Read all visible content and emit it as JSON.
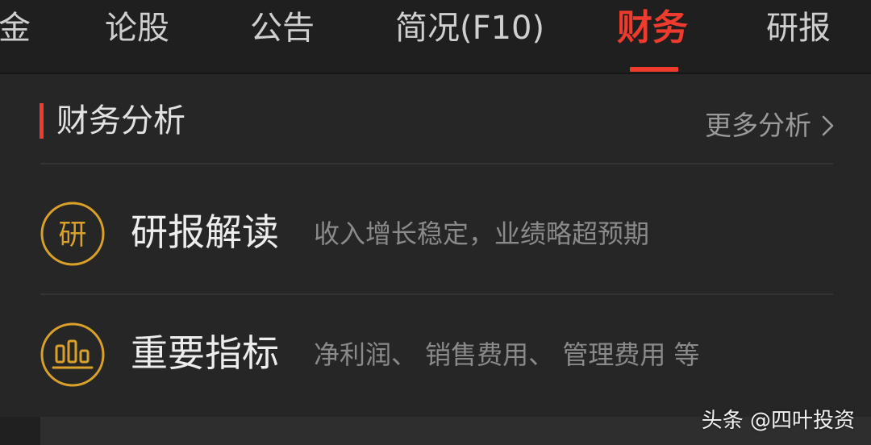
{
  "tabs": [
    {
      "label": "金",
      "active": false
    },
    {
      "label": "论股",
      "active": false
    },
    {
      "label": "公告",
      "active": false
    },
    {
      "label": "简况(F10)",
      "active": false
    },
    {
      "label": "财务",
      "active": true
    },
    {
      "label": "研报",
      "active": false
    }
  ],
  "section": {
    "title": "财务分析",
    "more_label": "更多分析",
    "more_icon": "chevron-right-icon"
  },
  "rows": [
    {
      "icon": "research-report-icon",
      "icon_glyph": "研",
      "title": "研报解读",
      "description": "收入增长稳定，业绩略超预期"
    },
    {
      "icon": "bar-chart-icon",
      "title": "重要指标",
      "description": "净利润、 销售费用、 管理费用 等"
    }
  ],
  "watermark": "头条 @四叶投资",
  "colors": {
    "accent": "#ef3b2d",
    "icon_gold": "#d9a12a",
    "background": "#202020",
    "panel": "#262626"
  }
}
